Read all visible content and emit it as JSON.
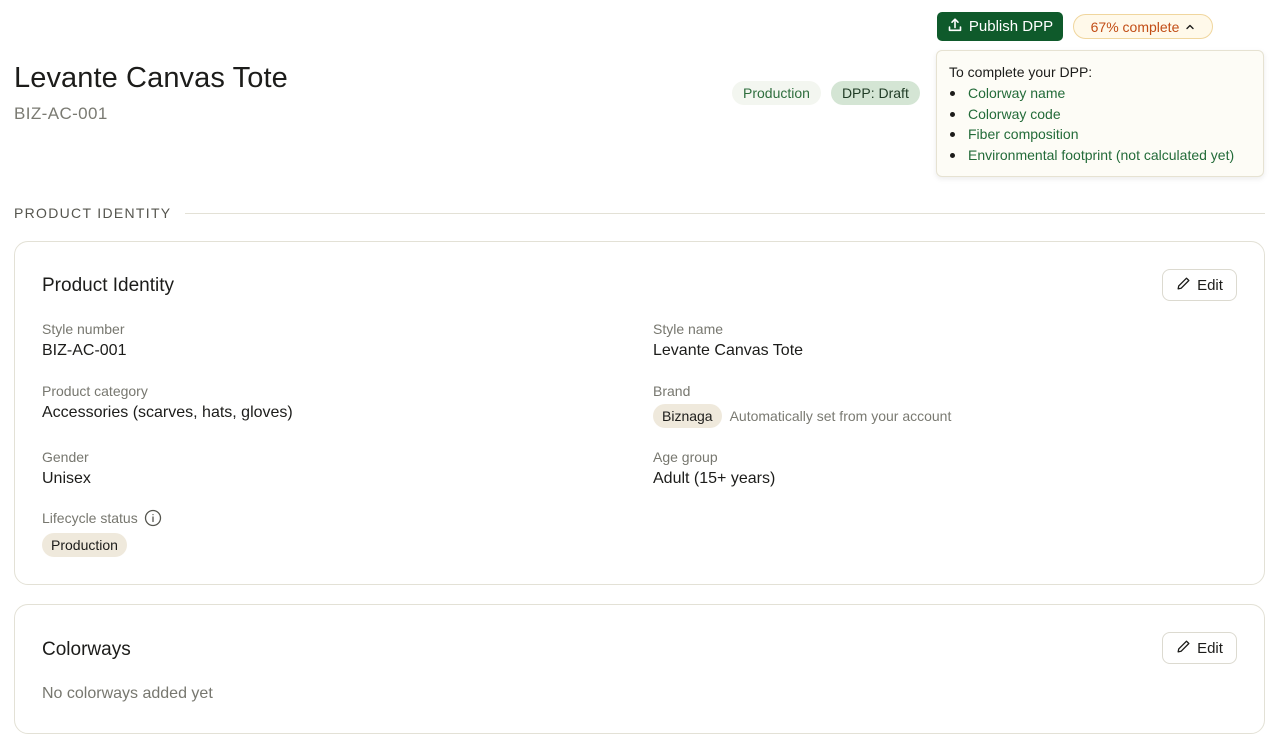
{
  "header": {
    "title": "Levante Canvas Tote",
    "sku": "BIZ-AC-001",
    "badges": {
      "lifecycle": "Production",
      "dpp_status": "DPP: Draft"
    },
    "publish_label": "Publish DPP",
    "progress_label": "67% complete",
    "progress_percent": 67
  },
  "todo": {
    "title": "To complete your DPP:",
    "items": [
      "Colorway name",
      "Colorway code",
      "Fiber composition",
      "Environmental footprint (not calculated yet)"
    ]
  },
  "section": {
    "label": "PRODUCT IDENTITY"
  },
  "identity_card": {
    "title": "Product Identity",
    "edit_label": "Edit",
    "style_number": {
      "label": "Style number",
      "value": "BIZ-AC-001"
    },
    "style_name": {
      "label": "Style name",
      "value": "Levante Canvas Tote"
    },
    "product_category": {
      "label": "Product category",
      "value": "Accessories (scarves, hats, gloves)"
    },
    "brand": {
      "label": "Brand",
      "value": "Biznaga",
      "note": "Automatically set from your account"
    },
    "gender": {
      "label": "Gender",
      "value": "Unisex"
    },
    "age_group": {
      "label": "Age group",
      "value": "Adult (15+ years)"
    },
    "lifecycle_status": {
      "label": "Lifecycle status",
      "value": "Production"
    }
  },
  "colorways_card": {
    "title": "Colorways",
    "edit_label": "Edit",
    "empty_text": "No colorways added yet"
  },
  "colors": {
    "primary": "#0f5a2b",
    "progress_text": "#c24d16",
    "link_green": "#236b39"
  },
  "icons": {
    "publish": "upload-icon",
    "progress": "chevron-up-icon",
    "edit": "pencil-icon",
    "info": "info-icon"
  }
}
